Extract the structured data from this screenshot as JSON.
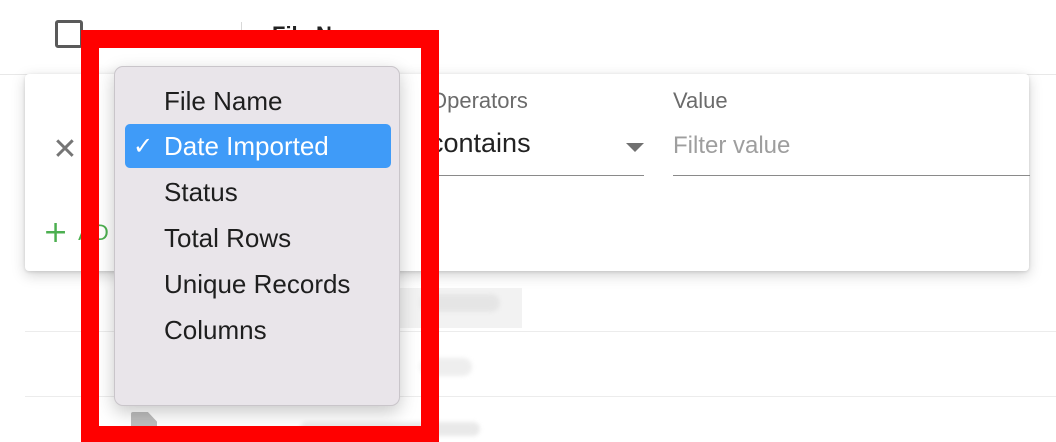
{
  "table": {
    "header": {
      "column_label": "File Name"
    }
  },
  "filter_panel": {
    "close_icon": "close-icon",
    "add_label": "AD",
    "add_icon": "plus-icon",
    "operator": {
      "label": "Operators",
      "value": "contains",
      "caret_icon": "caret-down-icon"
    },
    "value_field": {
      "label": "Value",
      "placeholder": "Filter value",
      "value": ""
    }
  },
  "columns_menu": {
    "check_glyph": "✓",
    "selected_index": 1,
    "items": [
      {
        "label": "File Name"
      },
      {
        "label": "Date Imported"
      },
      {
        "label": "Status"
      },
      {
        "label": "Total Rows"
      },
      {
        "label": "Unique Records"
      },
      {
        "label": "Columns"
      }
    ]
  },
  "colors": {
    "selection": "#3f9bf8",
    "highlight_frame": "#ff0000",
    "add_button": "#4caf50"
  }
}
